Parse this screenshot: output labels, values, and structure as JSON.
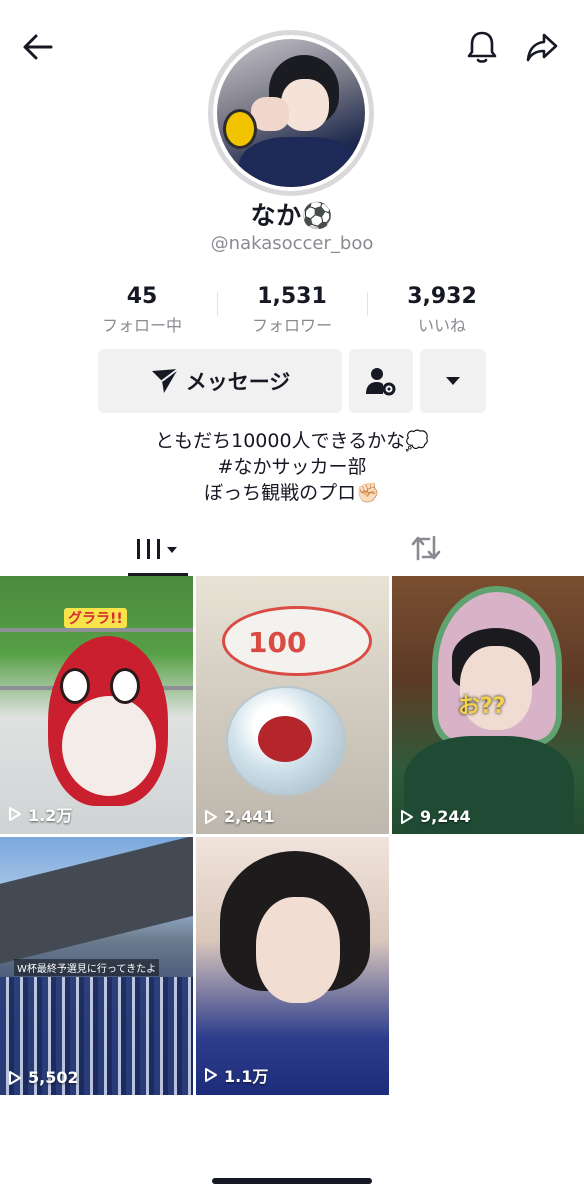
{
  "profile": {
    "display_name": "なか⚽",
    "handle": "@nakasoccer_boo"
  },
  "stats": [
    {
      "value": "45",
      "label": "フォロー中"
    },
    {
      "value": "1,531",
      "label": "フォロワー"
    },
    {
      "value": "3,932",
      "label": "いいね"
    }
  ],
  "actions": {
    "message_label": "メッセージ"
  },
  "bio": {
    "lines": [
      "ともだち10000人できるかな💭",
      "#なかサッカー部",
      "ぼっち観戦のプロ✊🏻"
    ]
  },
  "tabs": {
    "videos_icon": "grid-icon",
    "repost_icon": "repost-icon"
  },
  "videos": [
    {
      "views": "1.2万",
      "caption": "グララ!!"
    },
    {
      "views": "2,441",
      "caption": "100"
    },
    {
      "views": "9,244",
      "caption": "お??"
    },
    {
      "views": "5,502",
      "caption": "W杯最終予選見に行ってきたよ"
    },
    {
      "views": "1.1万",
      "caption": ""
    }
  ],
  "colors": {
    "text": "#161823",
    "muted": "#8a8b91",
    "button_bg": "#f1f1f2"
  }
}
